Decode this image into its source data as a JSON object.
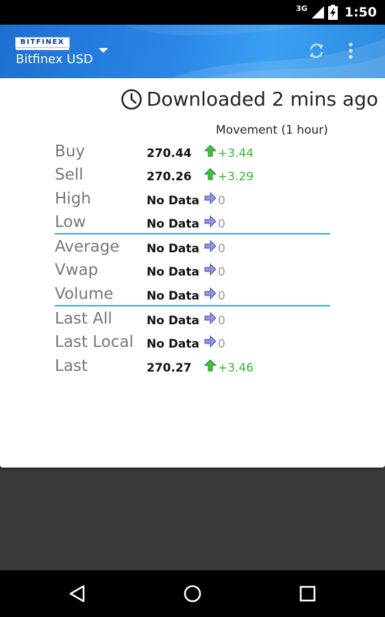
{
  "status_bar": {
    "network": "3G",
    "time": "1:50"
  },
  "app_bar": {
    "logo_text": "BITFINEX",
    "subtitle": "Bitfinex USD",
    "icons": [
      "dropdown-arrow-icon",
      "refresh-icon",
      "overflow-menu-icon"
    ]
  },
  "card": {
    "downloaded_text": "Downloaded 2 mins ago",
    "movement_header": "Movement (1 hour)",
    "rows": [
      {
        "label": "Buy",
        "value": "270.44",
        "change": "+3.44",
        "direction": "up"
      },
      {
        "label": "Sell",
        "value": "270.26",
        "change": "+3.29",
        "direction": "up"
      },
      {
        "label": "High",
        "value": "No Data",
        "change": "0",
        "direction": "flat"
      },
      {
        "label": "Low",
        "value": "No Data",
        "change": "0",
        "direction": "flat"
      },
      {
        "label": "Average",
        "value": "No Data",
        "change": "0",
        "direction": "flat"
      },
      {
        "label": "Vwap",
        "value": "No Data",
        "change": "0",
        "direction": "flat"
      },
      {
        "label": "Volume",
        "value": "No Data",
        "change": "0",
        "direction": "flat"
      },
      {
        "label": "Last All",
        "value": "No Data",
        "change": "0",
        "direction": "flat"
      },
      {
        "label": "Last Local",
        "value": "No Data",
        "change": "0",
        "direction": "flat"
      },
      {
        "label": "Last",
        "value": "270.27",
        "change": "+3.46",
        "direction": "up"
      }
    ]
  },
  "colors": {
    "up": "#2dbb2d",
    "flat": "#999999",
    "accent": "#35a4e0",
    "appbar": "#2a86e6"
  },
  "nav_bar": {
    "icons": [
      "back-icon",
      "home-icon",
      "recents-icon"
    ]
  }
}
